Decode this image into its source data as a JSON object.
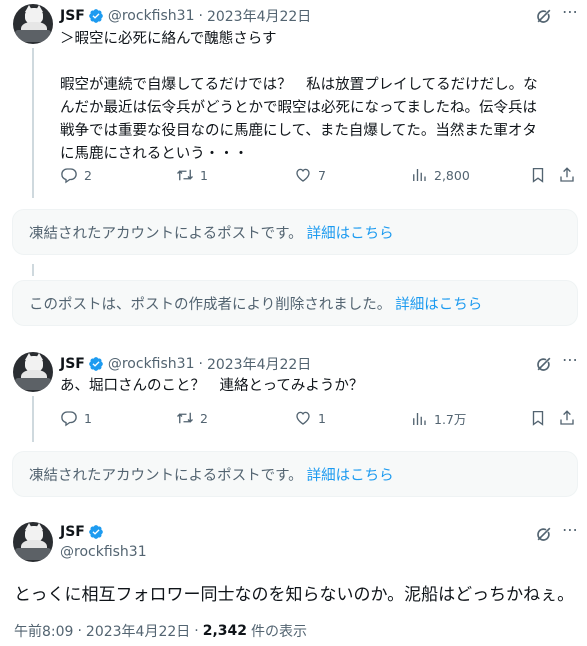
{
  "colors": {
    "accent": "#1d9bf0",
    "secondary_text": "#536471",
    "verified": "#1d9bf0"
  },
  "tweet1": {
    "name": "JSF",
    "handle": "@rockfish31",
    "separator": "·",
    "date": "2023年4月22日",
    "lines": [
      "＞暇空に必死に絡んで醜態さらす",
      "",
      "暇空が連続で自爆してるだけでは？　私は放置プレイしてるだけだし。な",
      "んだか最近は伝令兵がどうとかで暇空は必死になってましたね。伝令兵は",
      "戦争では重要な役目なのに馬鹿にして、また自爆してた。当然また軍オタ",
      "に馬鹿にされるという・・・"
    ],
    "replies": "2",
    "reposts": "1",
    "likes": "7",
    "views": "2,800"
  },
  "notice1": {
    "text": "凍結されたアカウントによるポストです。",
    "link": "詳細はこちら"
  },
  "notice2": {
    "text": "このポストは、ポストの作成者により削除されました。",
    "link": "詳細はこちら"
  },
  "tweet2": {
    "name": "JSF",
    "handle": "@rockfish31",
    "separator": "·",
    "date": "2023年4月22日",
    "text": "あ、堀口さんのこと？　連絡とってみようか？",
    "replies": "1",
    "reposts": "2",
    "likes": "1",
    "views": "1.7万"
  },
  "notice3": {
    "text": "凍結されたアカウントによるポストです。",
    "link": "詳細はこちら"
  },
  "main_tweet": {
    "name": "JSF",
    "handle": "@rockfish31",
    "text": "とっくに相互フォロワー同士なのを知らないのか。泥船はどっちかねぇ。",
    "time": "午前8:09",
    "separator": "·",
    "date": "2023年4月22日",
    "separator2": "·",
    "views_count": "2,342",
    "views_label": "件の表示"
  },
  "icons": [
    "verified-badge-icon",
    "grok-icon",
    "more-icon",
    "reply-icon",
    "repost-icon",
    "like-icon",
    "views-icon",
    "bookmark-icon",
    "share-icon"
  ]
}
